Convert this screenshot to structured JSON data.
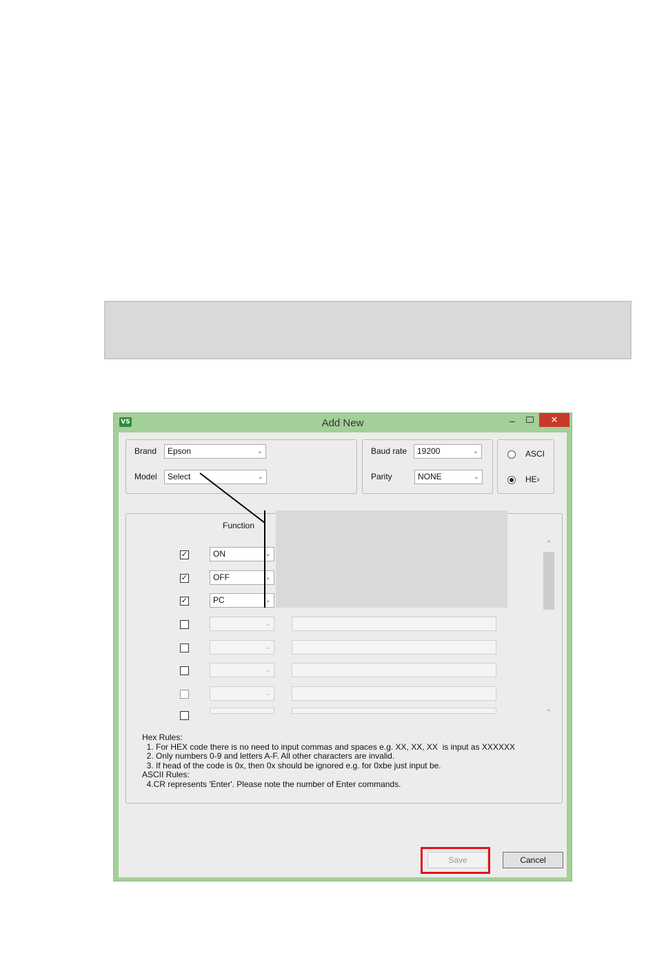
{
  "window": {
    "title": "Add New",
    "logo_text": "VS",
    "minimize_glyph": "–",
    "close_glyph": "✕"
  },
  "device": {
    "brand_label": "Brand",
    "brand_value": "Epson",
    "model_label": "Model",
    "model_value": "Select"
  },
  "serial": {
    "baud_label": "Baud rate",
    "baud_value": "19200",
    "parity_label": "Parity",
    "parity_value": "NONE"
  },
  "mode": {
    "ascii_label": "ASCI",
    "hex_label": "HE›",
    "selected": "hex"
  },
  "commands": {
    "function_header": "Function",
    "rows": [
      {
        "checked": true,
        "function": "ON"
      },
      {
        "checked": true,
        "function": "OFF"
      },
      {
        "checked": true,
        "function": "PC"
      },
      {
        "checked": false,
        "function": ""
      },
      {
        "checked": false,
        "function": ""
      },
      {
        "checked": false,
        "function": ""
      },
      {
        "checked": false,
        "function": ""
      },
      {
        "checked": false,
        "function": ""
      }
    ]
  },
  "rules": {
    "hex_title": "Hex Rules:",
    "hex_1": "  1. For HEX code there is no need to input commas and spaces e.g. XX, XX, XX  is input as XXXXXX",
    "hex_2": "  2. Only numbers 0-9 and letters A-F. All other characters are invalid.",
    "hex_3": "  3. If head of the code is 0x, then 0x should be ignored e.g. for 0xbe just input be.",
    "ascii_title": "ASCII Rules:",
    "ascii_4": "  4.CR represents 'Enter'. Please note the number of Enter commands."
  },
  "buttons": {
    "save": "Save",
    "cancel": "Cancel"
  },
  "colors": {
    "window_frame": "#a3cf98",
    "close_button": "#c7392b",
    "highlight": "#e0141e"
  }
}
